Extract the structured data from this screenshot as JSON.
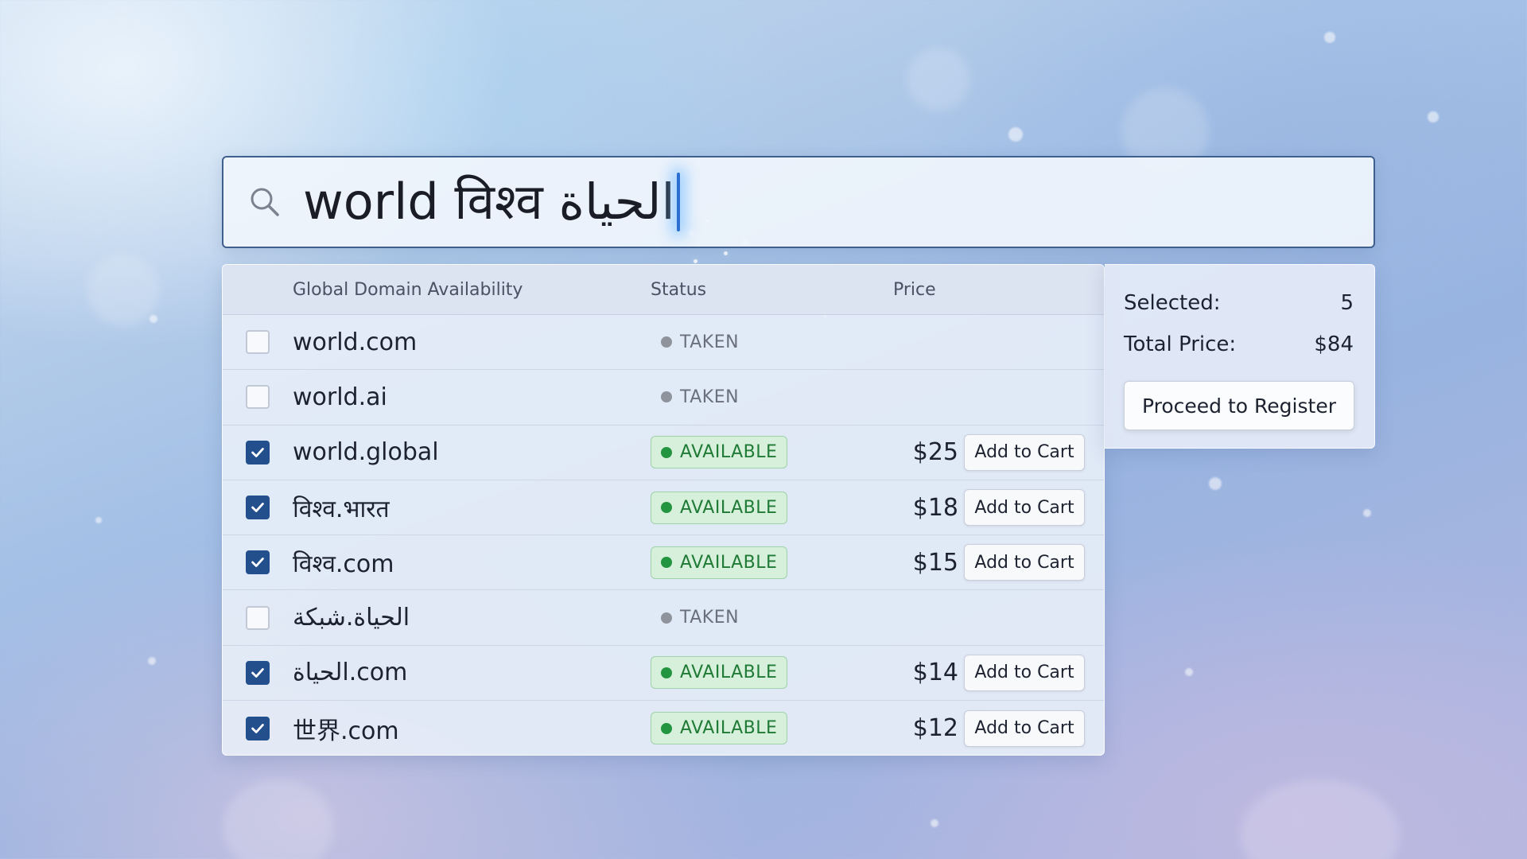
{
  "search": {
    "query": "world विश्व الحياة",
    "icon": "search-icon"
  },
  "results": {
    "headers": {
      "domain": "Global Domain Availability",
      "status": "Status",
      "price": "Price"
    },
    "rows": [
      {
        "domain": "world.com",
        "checked": false,
        "status": "TAKEN",
        "available": false,
        "price": "",
        "action": ""
      },
      {
        "domain": "world.ai",
        "checked": false,
        "status": "TAKEN",
        "available": false,
        "price": "",
        "action": ""
      },
      {
        "domain": "world.global",
        "checked": true,
        "status": "AVAILABLE",
        "available": true,
        "price": "$25",
        "action": "Add to Cart"
      },
      {
        "domain": "विश्व.भारत",
        "checked": true,
        "status": "AVAILABLE",
        "available": true,
        "price": "$18",
        "action": "Add to Cart"
      },
      {
        "domain": "विश्व.com",
        "checked": true,
        "status": "AVAILABLE",
        "available": true,
        "price": "$15",
        "action": "Add to Cart"
      },
      {
        "domain": "الحياة.شبكة",
        "checked": false,
        "status": "TAKEN",
        "available": false,
        "price": "",
        "action": ""
      },
      {
        "domain": "الحياة.com",
        "checked": true,
        "status": "AVAILABLE",
        "available": true,
        "price": "$14",
        "action": "Add to Cart"
      },
      {
        "domain": "世界.com",
        "checked": true,
        "status": "AVAILABLE",
        "available": true,
        "price": "$12",
        "action": "Add to Cart"
      }
    ]
  },
  "summary": {
    "selected_label": "Selected:",
    "selected_value": "5",
    "total_label": "Total Price:",
    "total_value": "$84",
    "register_label": "Proceed to Register"
  },
  "colors": {
    "accent": "#23508d",
    "available_bg": "#d7f0db",
    "available_text": "#1f7a35",
    "taken_text": "#6a707c"
  }
}
